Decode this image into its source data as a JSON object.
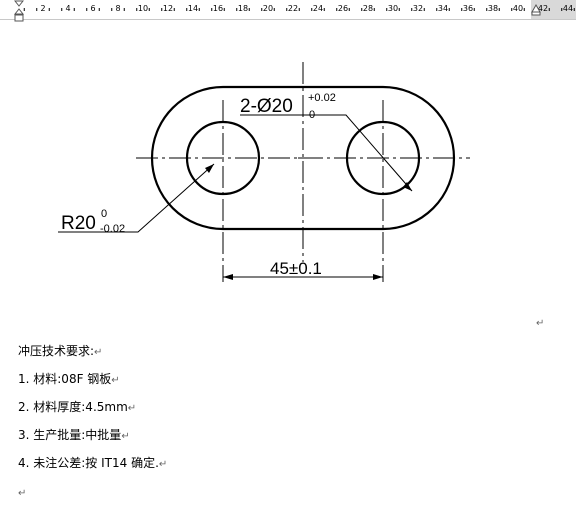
{
  "ruler": {
    "numbers": [
      "2",
      "4",
      "6",
      "8",
      "10",
      "12",
      "14",
      "16",
      "18",
      "20",
      "22",
      "24",
      "26",
      "28",
      "30",
      "32",
      "34",
      "36",
      "38",
      "40",
      "42",
      "44"
    ]
  },
  "drawing": {
    "hole_dim": {
      "prefix": "2-Ø20",
      "sup": "+0.02",
      "sub": "0"
    },
    "radius_dim": {
      "prefix": "R20",
      "sup": "0",
      "sub": "-0.02"
    },
    "spacing_dim": "45±0.1"
  },
  "text": {
    "heading": "冲压技术要求:",
    "items": [
      "1. 材料:08F 钢板",
      "2. 材料厚度:4.5mm",
      "3. 生产批量:中批量",
      "4. 未注公差:按 IT14 确定."
    ]
  },
  "para_mark": "↵",
  "colors": {
    "line": "#000000",
    "ruler_border": "#c8c8c8",
    "ruler_highlight": "#d9d9d9",
    "para_mark": "#666666"
  },
  "icons": {
    "indent": "indent-marker-icon",
    "tab": "tab-stop-icon"
  }
}
